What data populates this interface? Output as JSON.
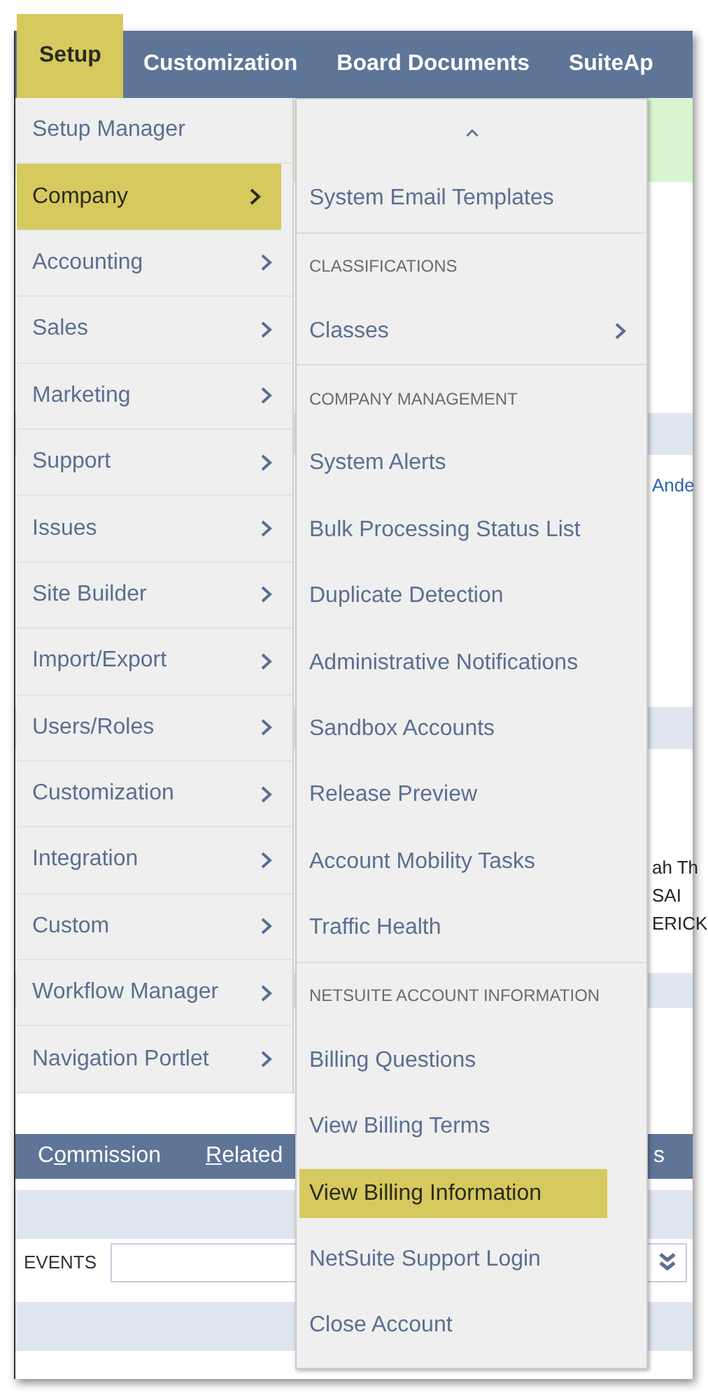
{
  "top_nav": [
    {
      "label": "Setup",
      "selected": true
    },
    {
      "label": "Customization",
      "selected": false
    },
    {
      "label": "Board Documents",
      "selected": false
    },
    {
      "label": "SuiteAp",
      "selected": false
    }
  ],
  "setup_menu": [
    {
      "label": "Setup Manager",
      "submenu": false,
      "selected": false
    },
    {
      "label": "Company",
      "submenu": true,
      "selected": true
    },
    {
      "label": "Accounting",
      "submenu": true,
      "selected": false
    },
    {
      "label": "Sales",
      "submenu": true,
      "selected": false
    },
    {
      "label": "Marketing",
      "submenu": true,
      "selected": false
    },
    {
      "label": "Support",
      "submenu": true,
      "selected": false
    },
    {
      "label": "Issues",
      "submenu": true,
      "selected": false
    },
    {
      "label": "Site Builder",
      "submenu": true,
      "selected": false
    },
    {
      "label": "Import/Export",
      "submenu": true,
      "selected": false
    },
    {
      "label": "Users/Roles",
      "submenu": true,
      "selected": false
    },
    {
      "label": "Customization",
      "submenu": true,
      "selected": false
    },
    {
      "label": "Integration",
      "submenu": true,
      "selected": false
    },
    {
      "label": "Custom",
      "submenu": true,
      "selected": false
    },
    {
      "label": "Workflow Manager",
      "submenu": true,
      "selected": false
    },
    {
      "label": "Navigation Portlet",
      "submenu": true,
      "selected": false
    }
  ],
  "company_menu": [
    {
      "kind": "item",
      "label": "System Email Templates",
      "submenu": false,
      "selected": false
    },
    {
      "kind": "header",
      "label": "CLASSIFICATIONS"
    },
    {
      "kind": "item",
      "label": "Classes",
      "submenu": true,
      "selected": false
    },
    {
      "kind": "header",
      "label": "COMPANY MANAGEMENT"
    },
    {
      "kind": "item",
      "label": "System Alerts",
      "submenu": false,
      "selected": false
    },
    {
      "kind": "item",
      "label": "Bulk Processing Status List",
      "submenu": false,
      "selected": false
    },
    {
      "kind": "item",
      "label": "Duplicate Detection",
      "submenu": false,
      "selected": false
    },
    {
      "kind": "item",
      "label": "Administrative Notifications",
      "submenu": false,
      "selected": false
    },
    {
      "kind": "item",
      "label": "Sandbox Accounts",
      "submenu": false,
      "selected": false
    },
    {
      "kind": "item",
      "label": "Release Preview",
      "submenu": false,
      "selected": false
    },
    {
      "kind": "item",
      "label": "Account Mobility Tasks",
      "submenu": false,
      "selected": false
    },
    {
      "kind": "item",
      "label": "Traffic Health",
      "submenu": false,
      "selected": false
    },
    {
      "kind": "header",
      "label": "NETSUITE ACCOUNT INFORMATION"
    },
    {
      "kind": "item",
      "label": "Billing Questions",
      "submenu": false,
      "selected": false
    },
    {
      "kind": "item",
      "label": "View Billing Terms",
      "submenu": false,
      "selected": false
    },
    {
      "kind": "item",
      "label": "View Billing Information",
      "submenu": false,
      "selected": true
    },
    {
      "kind": "item",
      "label": "NetSuite Support Login",
      "submenu": false,
      "selected": false
    },
    {
      "kind": "item",
      "label": "Close Account",
      "submenu": false,
      "selected": false
    }
  ],
  "background": {
    "link_fragment": "Ande",
    "text_fragments": [
      "ah Th",
      "SAI",
      "ERICK"
    ],
    "subtabs": [
      {
        "before": "C",
        "key": "o",
        "after": "mmission"
      },
      {
        "key": "R",
        "after": "elated"
      },
      {
        "before": "s"
      }
    ],
    "events_label": "EVENTS"
  }
}
